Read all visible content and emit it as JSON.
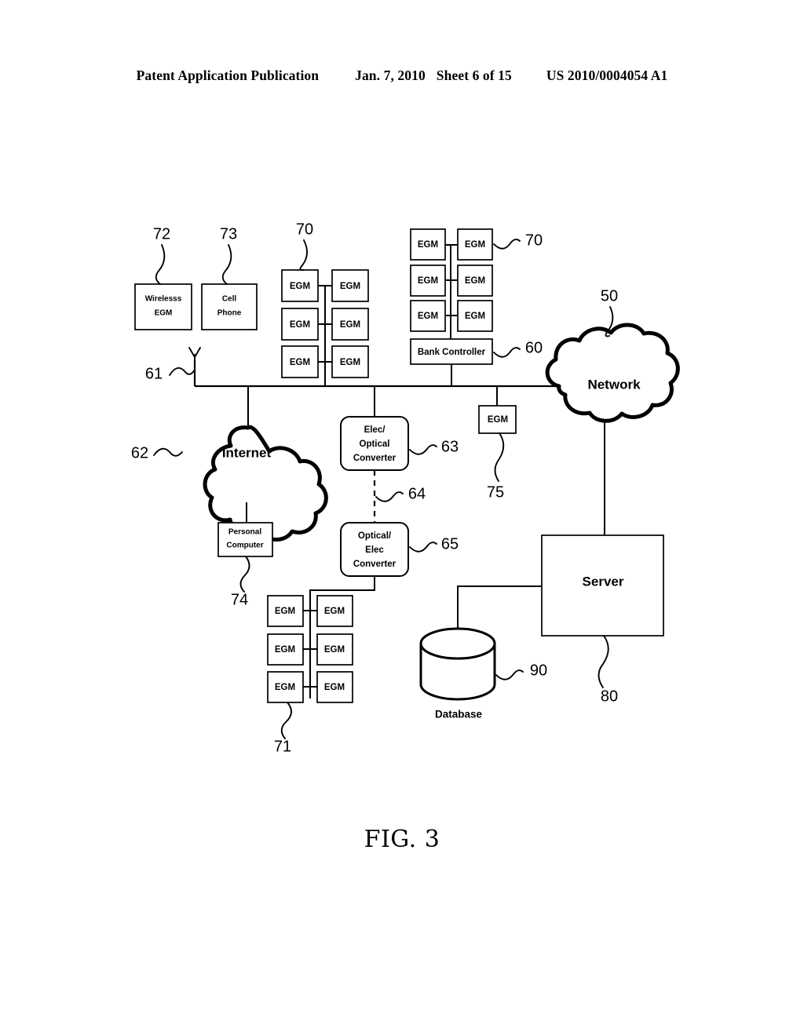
{
  "header": {
    "publication": "Patent Application Publication",
    "date": "Jan. 7, 2010",
    "sheet": "Sheet 6 of 15",
    "patent_number": "US 2010/0004054 A1"
  },
  "figure": {
    "caption": "FIG. 3"
  },
  "diagram": {
    "nodes": {
      "wireless_egm": "Wirelesss\nEGM",
      "wireless_egm_line1": "Wirelesss",
      "wireless_egm_line2": "EGM",
      "cell_phone_line1": "Cell",
      "cell_phone_line2": "Phone",
      "egm": "EGM",
      "bank_controller": "Bank Controller",
      "network": "Network",
      "internet": "Internet",
      "elec_optical_line1": "Elec/",
      "elec_optical_line2": "Optical",
      "elec_optical_line3": "Converter",
      "optical_elec_line1": "Optical/",
      "optical_elec_line2": "Elec",
      "optical_elec_line3": "Converter",
      "personal_computer_line1": "Personal",
      "personal_computer_line2": "Computer",
      "server": "Server",
      "database": "Database"
    },
    "reference_numerals": {
      "wireless_egm": "72",
      "cell_phone": "73",
      "egm_bank_left": "70",
      "egm_bank_right": "70",
      "bank_controller": "60",
      "network": "50",
      "bus": "61",
      "internet": "62",
      "elec_optical_converter": "63",
      "optical_link": "64",
      "optical_elec_converter": "65",
      "egm_standalone": "75",
      "personal_computer": "74",
      "egm_bank_bottom": "71",
      "server": "80",
      "database": "90"
    },
    "egm_bank_left": {
      "rows": [
        [
          "EGM",
          "EGM"
        ],
        [
          "EGM",
          "EGM"
        ],
        [
          "EGM",
          "EGM"
        ]
      ]
    },
    "egm_bank_right": {
      "rows": [
        [
          "EGM",
          "EGM"
        ],
        [
          "EGM",
          "EGM"
        ],
        [
          "EGM",
          "EGM"
        ]
      ]
    },
    "egm_bank_bottom": {
      "rows": [
        [
          "EGM",
          "EGM"
        ],
        [
          "EGM",
          "EGM"
        ],
        [
          "EGM",
          "EGM"
        ]
      ]
    },
    "egm_standalone": "EGM"
  },
  "colors": {
    "ink": "#000000",
    "paper": "#ffffff"
  }
}
